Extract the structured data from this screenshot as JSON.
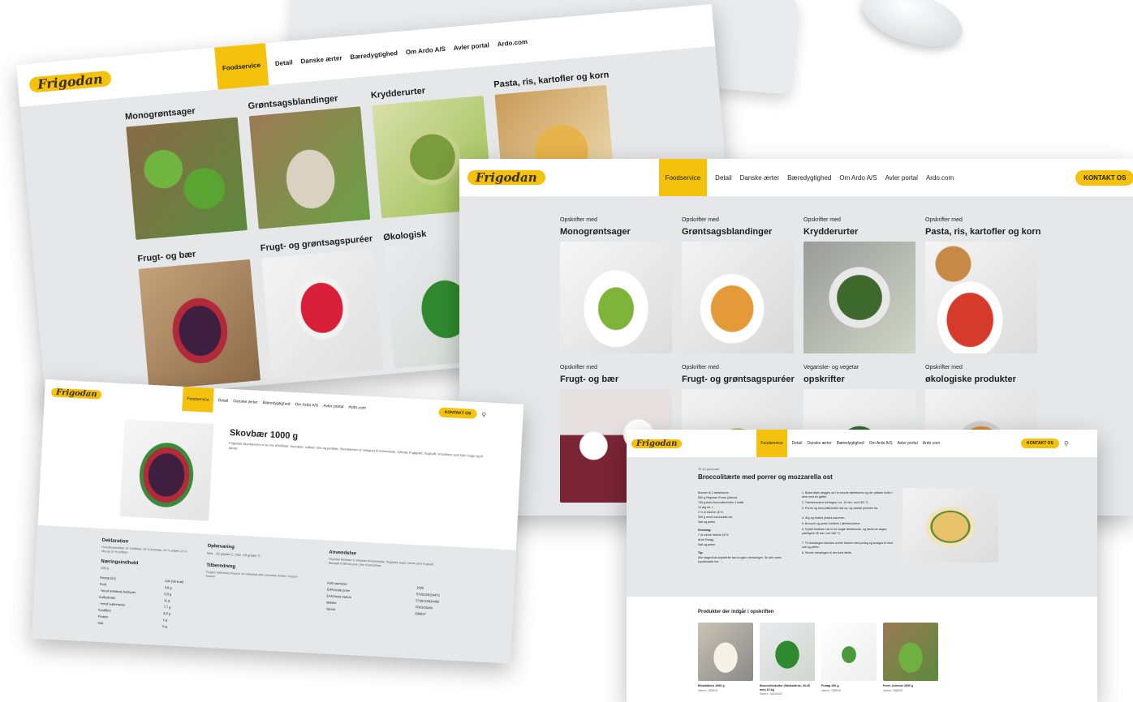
{
  "colors": {
    "accent": "#f4c20d",
    "page_bg": "#e6e7e8",
    "text": "#1e1e1e"
  },
  "brand": {
    "logo": "Frigodan"
  },
  "nav": {
    "items": [
      "Foodservice",
      "Detail",
      "Danske ærter",
      "Bæredygtighed",
      "Om Ardo A/S",
      "Avler portal",
      "Ardo.com"
    ],
    "contact": "KONTAKT OS",
    "search_icon": "search-icon"
  },
  "screen1": {
    "categories": [
      "Monogrøntsager",
      "Grøntsagsblandinger",
      "Krydderurter",
      "Pasta, ris, kartofler og korn",
      "Frugt- og bær",
      "Frugt- og grøntsagspuréer",
      "Økologisk"
    ]
  },
  "screen2": {
    "cards": [
      {
        "sub": "Opskrifter med",
        "title": "Monogrøntsager"
      },
      {
        "sub": "Opskrifter med",
        "title": "Grøntsagsblandinger"
      },
      {
        "sub": "Opskrifter med",
        "title": "Krydderurter"
      },
      {
        "sub": "Opskrifter med",
        "title": "Pasta, ris, kartofler og korn"
      },
      {
        "sub": "Opskrifter med",
        "title": "Frugt- og bær"
      },
      {
        "sub": "Opskrifter med",
        "title": "Frugt- og grøntsagspuréer"
      },
      {
        "sub": "Veganske- og vegetar",
        "title": "opskrifter"
      },
      {
        "sub": "Opskrifter med",
        "title": "økologiske produkter"
      }
    ]
  },
  "screen3": {
    "product_title": "Skovbær 1000 g",
    "product_desc": "Frigodan Skovbærmix er et mix af blåbær, brombær, solbær, ribs og jordbær. Skovbærmix er velegnet til marmelade, syltetøj, frugtgrød, frugtsaft, smoothies som fyld i kage og til tærter.",
    "sections": [
      "Deklaration",
      "Opbevaring",
      "Anvendelse",
      "Næringsindhold",
      "Tilberedning"
    ],
    "declaration": "Hovedbestanddel: 25 % Blåbær, 25 % brombær, 20 % solbær, 20 % ribs og 10 % jordbær",
    "storage": "Max. -18 grader C, max -18 grader C.",
    "preparation": "Frugten opbevares frossen, tø i køleskab eller anvendes direkte i frossen tilstand.",
    "usage": "Frigodan Skovbær er velegnet til marmelade, frugtgrød, kager, tærter samt frugtsaft. Mængde til Blendt pure, plus til smoothies.",
    "nutrition_per": "100 g",
    "nutrition": [
      {
        "label": "Energi (kJ)",
        "value": "234 (56 kcal)"
      },
      {
        "label": "Fedt",
        "value": "0,8 g"
      },
      {
        "label": "- heraf mættede fedtsyrer",
        "value": "0,0 g"
      },
      {
        "label": "Kulhydrater",
        "value": "11 g"
      },
      {
        "label": "- heraf sukkerarter",
        "value": "7,7 g"
      },
      {
        "label": "Kostfibre",
        "value": "3,8 g"
      },
      {
        "label": "Protein",
        "value": "1 g"
      },
      {
        "label": "Salt",
        "value": "0 g"
      }
    ],
    "item_codes": [
      {
        "label": "Kolli størrelse",
        "value": "1000"
      },
      {
        "label": "EAN-kode pose",
        "value": "5709123024475"
      },
      {
        "label": "EAN-kode karton",
        "value": "5709123024482"
      },
      {
        "label": "Mærke",
        "value": "FRIGODAN"
      },
      {
        "label": "Varenr.",
        "value": "838627"
      }
    ]
  },
  "screen4": {
    "persons": "Til 10 personer",
    "title": "Broccolitærte med porrer og mozzarella ost",
    "ingredients": [
      "Bunden til 2 tærteforme:",
      "550 g Frigodan Porrer julienne",
      "750 g Ardo Broccolibuketter 3 skåle",
      "14 æg str. L",
      "2 ½ dl fraiche 18 %",
      "300 g revet mozzarella ost",
      "Salt og peber"
    ],
    "dressing_label": "Dressing:",
    "dressing": [
      "7 dl creme fraiche 18 %",
      "Ardo Purløg",
      "Salt og peber"
    ],
    "tip_label": "Tip:",
    "tip": "Alle slags Ardo krydderier kan bruges i dressingen. Se alle vores krydderurter her →",
    "steps": [
      "1. Butterdejen lægges ud i to smurte tærteforme og der prikkes huller i dem med en gaffel.",
      "2. Tærtebundene forbages i ca. 10 min. ved 180 °C.",
      "3. Porrer og broccolibuketter tøs op, og vandet presses fra.",
      "4. Æg og fraiche piskes sammen.",
      "5. Broccoli og porrer fordeles i tærtebundene.",
      "6. Fyldet fordeles i de to for-bagte tærtebunde, og tærterne bages yderligere 35 min. ved 180 °C.",
      "7. Til dressingen blandes creme fraiche med purløg og smages til med salt og peber.",
      "8. Servér dressingen til den lune tærte."
    ],
    "products_heading": "Produkter der indgår i opskriften",
    "products": [
      {
        "name": "Blomkålsris 2500 g",
        "code": "Varenr.: 839513"
      },
      {
        "name": "Broccolibuketter (håndskårne, 20-40 mm) 10 kg",
        "code": "Varenr.: 16415422"
      },
      {
        "name": "Purløg 250 g",
        "code": "Varenr.: 838619"
      },
      {
        "name": "Porre Julienne 2500 g",
        "code": "Varenr.: 838634"
      }
    ]
  }
}
